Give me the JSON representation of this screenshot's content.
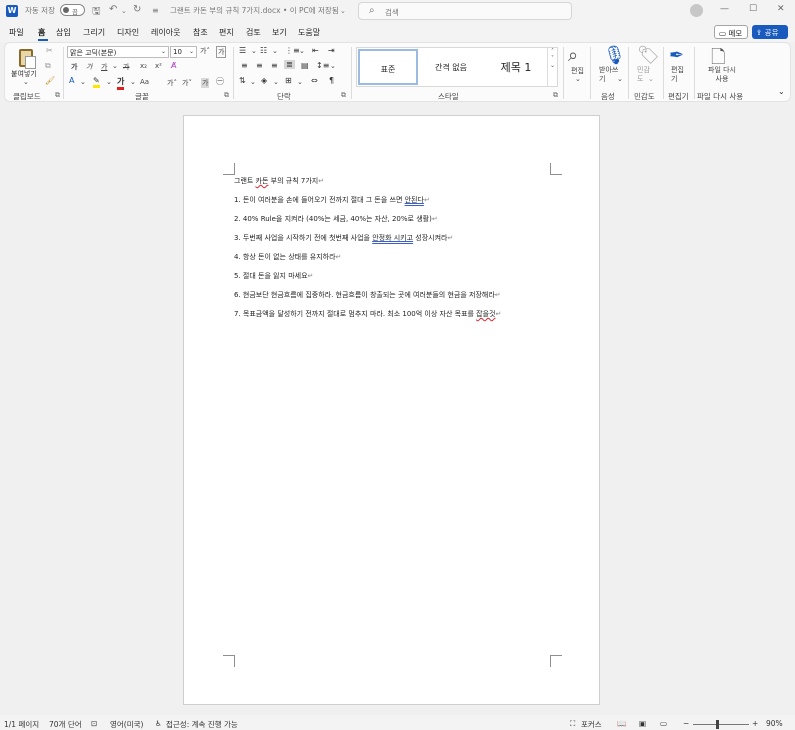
{
  "titlebar": {
    "app_icon": "W",
    "autosave_label": "자동 저장",
    "autosave_state": "끔",
    "doc_title": "그랜트 카돈 부의 규칙 7가지.docx • 이 PC에 저장됨",
    "search_placeholder": "검색",
    "qat_icons": [
      "save-icon",
      "undo-icon",
      "redo-icon"
    ]
  },
  "menu": {
    "tabs": [
      "파일",
      "홈",
      "삽입",
      "그리기",
      "디자인",
      "레이아웃",
      "참조",
      "편지",
      "검토",
      "보기",
      "도움말"
    ],
    "active_tab": "홈",
    "memo_label": "메모",
    "share_label": "공유"
  },
  "ribbon": {
    "clipboard": {
      "paste_label": "붙여넣기",
      "group_label": "클립보드"
    },
    "font": {
      "font_name": "맑은 고딕(본문)",
      "font_size": "10",
      "group_label": "글꼴",
      "bold": "가",
      "italic": "가",
      "underline": "가",
      "strike": "가",
      "subscript": "x₂",
      "superscript": "x²",
      "font_color_glyph": "가",
      "grow": "가˄",
      "shrink": "가˅",
      "case": "Aa",
      "clear": "가"
    },
    "paragraph": {
      "group_label": "단락"
    },
    "styles": {
      "items": [
        "표준",
        "간격 없음",
        "제목 1"
      ],
      "selected": "표준",
      "group_label": "스타일"
    },
    "editing": {
      "label": "편집"
    },
    "voice": {
      "label": "받아쓰기",
      "group_label": "음성"
    },
    "sensitivity": {
      "label": "민감도",
      "group_label": "민감도"
    },
    "editor": {
      "label": "편집기",
      "group_label": "편집기"
    },
    "reuse": {
      "label": "파일 다시 사용",
      "group_label": "파일 다시 사용"
    }
  },
  "document": {
    "lines": [
      {
        "text": "그랜트 카돈 부의 규칙 7가지",
        "marks": [
          {
            "text": "카돈",
            "type": "spell"
          }
        ]
      },
      {
        "text": "1. 돈이 여러분을 손에 들어오기 전까지 절대 그 돈을 쓰면 안된다",
        "marks": [
          {
            "text": "안된다",
            "type": "grammar"
          }
        ]
      },
      {
        "text": "2. 40% Rule을 지켜라 (40%는 세금, 40%는 자산, 20%로 생활)",
        "marks": []
      },
      {
        "text": "3. 두번째 사업을 시작하기 전에 첫번째 사업을 안정화 시키고 성장시켜라",
        "marks": [
          {
            "text": "안정화 시키고",
            "type": "grammar"
          }
        ]
      },
      {
        "text": "4. 항상 돈이 없는 상태를 유지하라",
        "marks": []
      },
      {
        "text": "5. 절대 돈을 잃지 마세요",
        "marks": []
      },
      {
        "text": "6. 현금보단 현금흐름에 집중하라. 현금흐름이 창출되는 곳에 여러분들의 현금을 저장해라",
        "marks": []
      },
      {
        "text": "7. 목표금액을 달성하기 전까지 절대로 멈추지 마라. 최소 100억 이상 자산 목표를 잡을것",
        "marks": [
          {
            "text": "잡을것",
            "type": "spell"
          }
        ]
      }
    ],
    "paragraph_mark": "↵"
  },
  "status": {
    "page": "1/1 페이지",
    "words": "70개 단어",
    "language": "영어(미국)",
    "accessibility": "접근성: 계속 진행 가능",
    "focus": "포커스",
    "zoom": "90%",
    "zoom_minus": "−",
    "zoom_plus": "+"
  },
  "colors": {
    "accent": "#185abd",
    "spell": "#d23333",
    "grammar": "#3a5fd0"
  }
}
